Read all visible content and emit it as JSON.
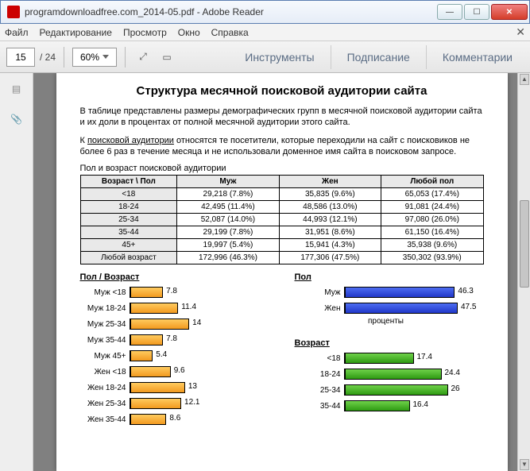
{
  "window": {
    "title": "programdownloadfree.com_2014-05.pdf - Adobe Reader"
  },
  "menu": {
    "file": "Файл",
    "edit": "Редактирование",
    "view": "Просмотр",
    "window": "Окно",
    "help": "Справка"
  },
  "toolbar": {
    "page_current": "15",
    "page_total": "/ 24",
    "zoom": "60%",
    "tools": "Инструменты",
    "sign": "Подписание",
    "comments": "Комментарии"
  },
  "doc": {
    "heading": "Структура месячной поисковой аудитории сайта",
    "p1": "В таблице представлены размеры демографических групп в месячной поисковой аудитории сайта и их доли в процентах от полной месячной аудитории этого сайта.",
    "p2a": "К ",
    "p2u": "поисковой аудитории",
    "p2b": " относятся те посетители, которые переходили на сайт с поисковиков не более 6 раз в течение месяца и не использовали доменное имя сайта в поисковом запросе.",
    "table_caption": "Пол и возраст поисковой аудитории",
    "table": {
      "h_age": "Возраст \\ Пол",
      "h_m": "Муж",
      "h_f": "Жен",
      "h_any": "Любой пол",
      "rows": [
        {
          "age": "<18",
          "m": "29,218 (7.8%)",
          "f": "35,835 (9.6%)",
          "a": "65,053 (17.4%)"
        },
        {
          "age": "18-24",
          "m": "42,495 (11.4%)",
          "f": "48,586 (13.0%)",
          "a": "91,081 (24.4%)"
        },
        {
          "age": "25-34",
          "m": "52,087 (14.0%)",
          "f": "44,993 (12.1%)",
          "a": "97,080 (26.0%)"
        },
        {
          "age": "35-44",
          "m": "29,199 (7.8%)",
          "f": "31,951 (8.6%)",
          "a": "61,150 (16.4%)"
        },
        {
          "age": "45+",
          "m": "19,997 (5.4%)",
          "f": "15,941 (4.3%)",
          "a": "35,938 (9.6%)"
        },
        {
          "age": "Любой возраст",
          "m": "172,996 (46.3%)",
          "f": "177,306 (47.5%)",
          "a": "350,302 (93.9%)"
        }
      ]
    },
    "charts_axis_label": "проценты",
    "chart_sexage_title": "Пол / Возраст",
    "chart_sex_title": "Пол",
    "chart_age_title": "Возраст"
  },
  "chart_data": [
    {
      "type": "bar",
      "title": "Пол / Возраст",
      "xlabel": "проценты",
      "orientation": "horizontal",
      "color": "#f29a1f",
      "xlim": [
        0,
        30
      ],
      "categories": [
        "Муж <18",
        "Муж 18-24",
        "Муж 25-34",
        "Муж 35-44",
        "Муж 45+",
        "Жен <18",
        "Жен 18-24",
        "Жен 25-34",
        "Жен 35-44"
      ],
      "values": [
        7.8,
        11.4,
        14.0,
        7.8,
        5.4,
        9.6,
        13.0,
        12.1,
        8.6
      ]
    },
    {
      "type": "bar",
      "title": "Пол",
      "xlabel": "проценты",
      "orientation": "horizontal",
      "color": "#2037c8",
      "xlim": [
        0,
        50
      ],
      "categories": [
        "Муж",
        "Жен"
      ],
      "values": [
        46.3,
        47.5
      ]
    },
    {
      "type": "bar",
      "title": "Возраст",
      "xlabel": "проценты",
      "orientation": "horizontal",
      "color": "#2e9a12",
      "xlim": [
        0,
        30
      ],
      "categories": [
        "<18",
        "18-24",
        "25-34",
        "35-44"
      ],
      "values": [
        17.4,
        24.4,
        26.0,
        16.4
      ]
    }
  ]
}
